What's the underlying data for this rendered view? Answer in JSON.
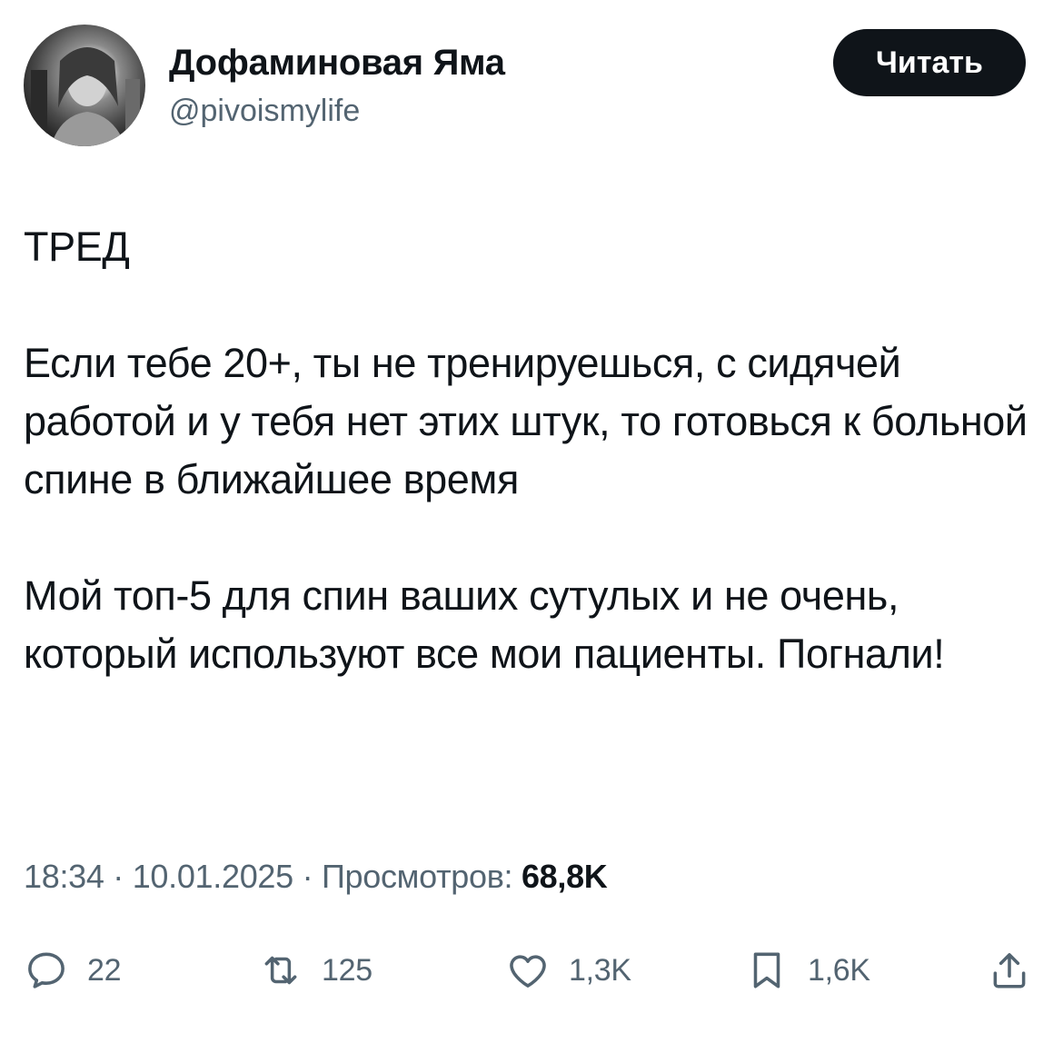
{
  "author": {
    "display_name": "Дофаминовая Яма",
    "handle": "@pivoismylife",
    "follow_label": "Читать"
  },
  "tweet": {
    "paragraphs": [
      "ТРЕД",
      "Если тебе 20+, ты не тренируешься, с сидячей работой и у тебя нет этих штук, то готовься к больной спине в ближайшее время",
      "Мой топ-5 для спин ваших сутулых и не очень, который используют все мои пациенты. Погнали!"
    ]
  },
  "meta": {
    "time": "18:34",
    "separator": " · ",
    "date": "10.01.2025",
    "views_label": "Просмотров: ",
    "views_count": "68,8K"
  },
  "actions": {
    "replies": "22",
    "retweets": "125",
    "likes": "1,3K",
    "bookmarks": "1,6K"
  },
  "icons": {
    "reply": "reply-icon",
    "retweet": "retweet-icon",
    "like": "heart-icon",
    "bookmark": "bookmark-icon",
    "share": "share-icon"
  },
  "colors": {
    "text": "#0f1419",
    "secondary": "#536471",
    "button_bg": "#0f1419",
    "button_text": "#ffffff"
  }
}
